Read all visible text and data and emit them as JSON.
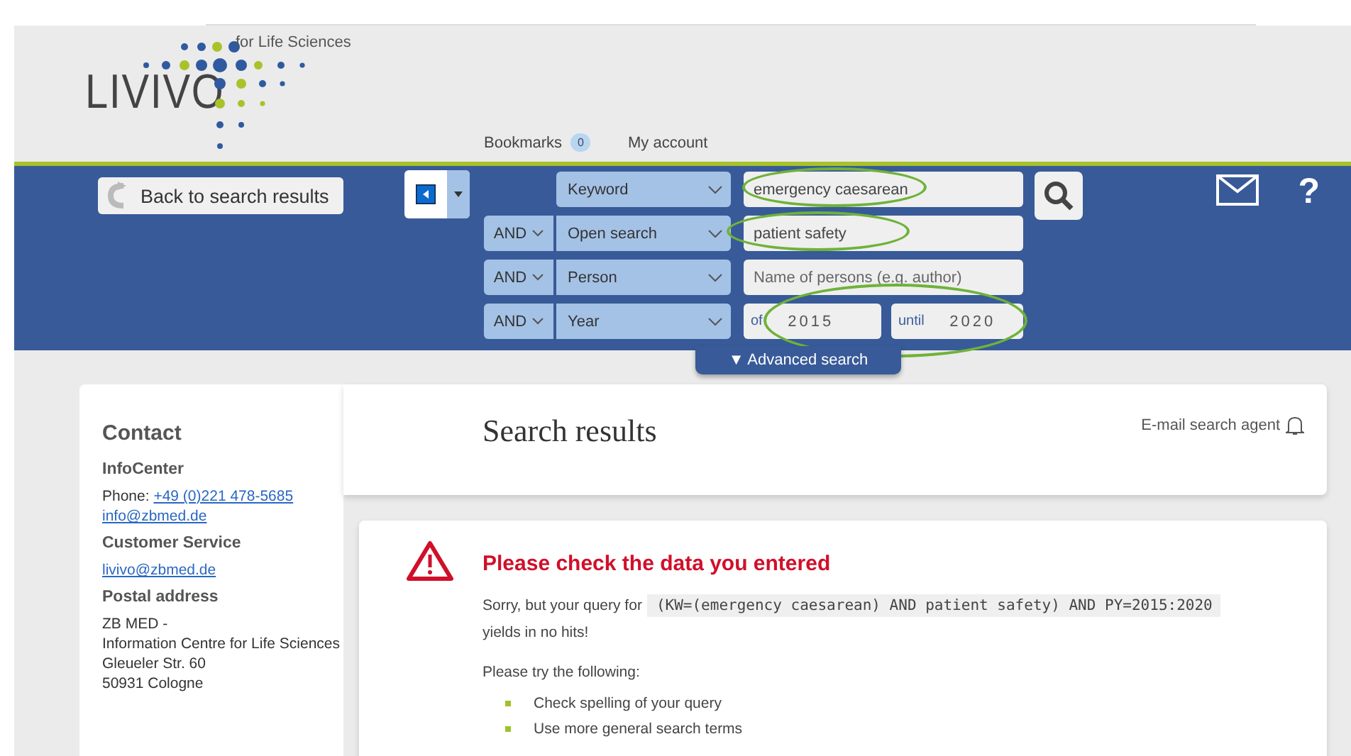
{
  "header": {
    "logo": {
      "name": "LIVIVO",
      "tagline": "for Life Sciences"
    },
    "nav": [
      {
        "label": "Bookmarks",
        "badge": "0"
      },
      {
        "label": "My account"
      }
    ]
  },
  "search": {
    "back_button": "Back to search results",
    "rows": [
      {
        "kind": "text",
        "field": "Keyword",
        "value": "emergency caesarean",
        "circled": true
      },
      {
        "kind": "text",
        "operator": "AND",
        "field": "Open search",
        "value": "patient safety",
        "circled": true
      },
      {
        "kind": "text",
        "operator": "AND",
        "field": "Person",
        "placeholder": "Name of persons (e.g. author)",
        "circled": false
      },
      {
        "kind": "range",
        "operator": "AND",
        "field": "Year",
        "from_label": "of",
        "from": "2015",
        "until_label": "until",
        "until": "2020",
        "circled": true
      }
    ],
    "advanced_search": "▼ Advanced search",
    "help": "?"
  },
  "sidebar": {
    "title": "Contact",
    "sections": [
      {
        "title": "InfoCenter",
        "lines": [
          {
            "label": "Phone:",
            "link": "+49 (0)221 478-5685"
          },
          {
            "link": "info@zbmed.de"
          }
        ]
      },
      {
        "title": "Customer Service",
        "lines": [
          {
            "link": "livivo@zbmed.de"
          }
        ]
      },
      {
        "title": "Postal address",
        "lines": [
          {
            "label": "ZB MED -"
          },
          {
            "label": "Information Centre for Life Sciences"
          },
          {
            "label": "Gleueler Str. 60"
          },
          {
            "label": "50931 Cologne"
          }
        ]
      }
    ]
  },
  "results": {
    "title": "Search results",
    "agent": "E-mail search agent"
  },
  "error": {
    "title": "Please check the data you entered",
    "prefix": "Sorry, but your query for",
    "query": "(KW=(emergency caesarean) AND patient safety) AND PY=2015:2020",
    "suffix": "yields in no hits!",
    "hint": "Please try the following:",
    "tips": [
      "Check spelling of your query",
      "Use more general search terms"
    ]
  }
}
